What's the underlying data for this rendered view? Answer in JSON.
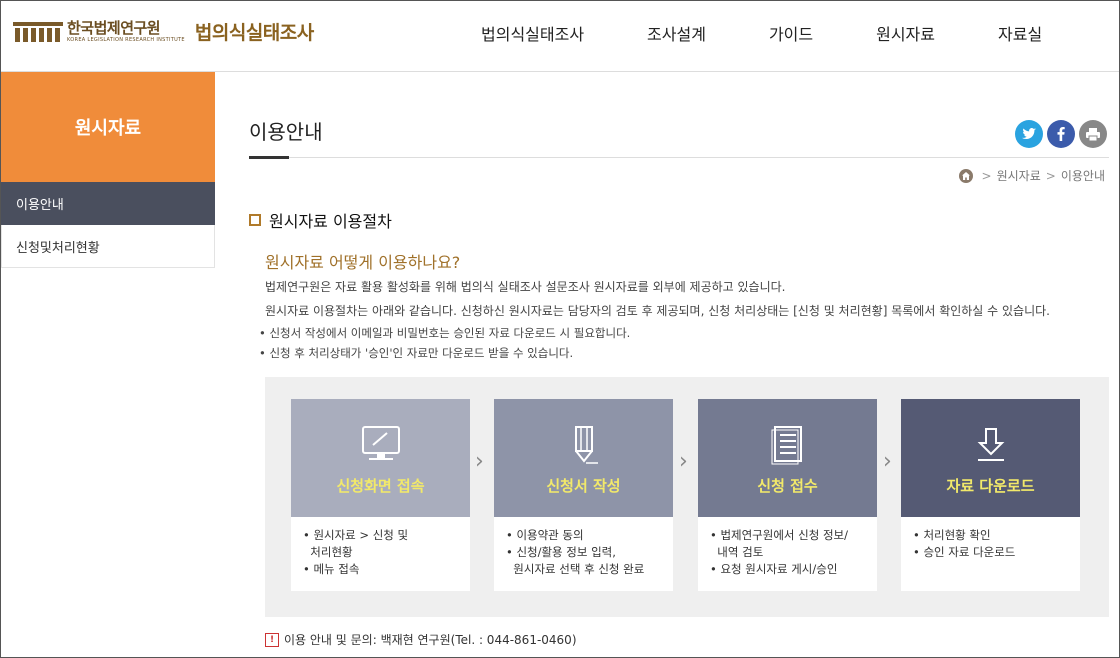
{
  "header": {
    "org_name_ko": "한국법제연구원",
    "org_name_en": "KOREA LEGISLATION RESEARCH INSTITUTE",
    "site_title": "법의식실태조사",
    "nav": [
      "법의식실태조사",
      "조사설계",
      "가이드",
      "원시자료",
      "자료실"
    ]
  },
  "sidebar": {
    "title": "원시자료",
    "items": [
      {
        "label": "이용안내",
        "active": true
      },
      {
        "label": "신청및처리현황",
        "active": false
      }
    ]
  },
  "main": {
    "page_title": "이용안내",
    "breadcrumb": [
      "원시자료",
      "이용안내"
    ],
    "section_title": "원시자료 이용절차",
    "question": "원시자료 어떻게 이용하나요?",
    "desc1": "법제연구원은 자료 활용 활성화를 위해 법의식 실태조사 설문조사 원시자료를 외부에 제공하고 있습니다.",
    "desc2": "원시자료 이용절차는 아래와 같습니다. 신청하신 원시자료는 담당자의 검토 후 제공되며, 신청 처리상태는 [신청 및 처리현황] 목록에서 확인하실 수 있습니다.",
    "note1": "• 신청서 작성에서 이메일과 비밀번호는 승인된 자료 다운로드 시 필요합니다.",
    "note2": "• 신청 후 처리상태가 '승인'인 자료만 다운로드 받을 수 있습니다.",
    "steps": [
      {
        "label": "신청화면 접속",
        "icon": "monitor-icon",
        "bg": "#a9adbd",
        "fg": "#f2e96a",
        "lines": [
          "• 원시자료 > 신청 및",
          "  처리현황",
          "• 메뉴 접속"
        ]
      },
      {
        "label": "신청서 작성",
        "icon": "pen-icon",
        "bg": "#8e94a8",
        "fg": "#f2e96a",
        "lines": [
          "• 이용약관 동의",
          "• 신청/활용 정보 입력,",
          "  원시자료 선택 후 신청 완료"
        ]
      },
      {
        "label": "신청 접수",
        "icon": "document-icon",
        "bg": "#747a91",
        "fg": "#f2e96a",
        "lines": [
          "• 법제연구원에서 신청 정보/",
          "  내역 검토",
          "• 요청 원시자료 게시/승인"
        ]
      },
      {
        "label": "자료 다운로드",
        "icon": "download-icon",
        "bg": "#555a74",
        "fg": "#f2e96a",
        "lines": [
          "• 처리현황 확인",
          "• 승인 자료 다운로드"
        ]
      }
    ],
    "contact": "이용 안내 및 문의: 백재현 연구원(Tel. : 044-861-0460)"
  },
  "share": [
    {
      "name": "twitter",
      "glyph": "t",
      "color": "#2aa3e0"
    },
    {
      "name": "facebook",
      "glyph": "f",
      "color": "#3b5bab"
    },
    {
      "name": "print",
      "glyph": "⎙",
      "color": "#888888"
    }
  ],
  "colors": {
    "accent": "#f08c3a",
    "sidebar_active": "#4a4f5e",
    "question": "#a0712a"
  }
}
